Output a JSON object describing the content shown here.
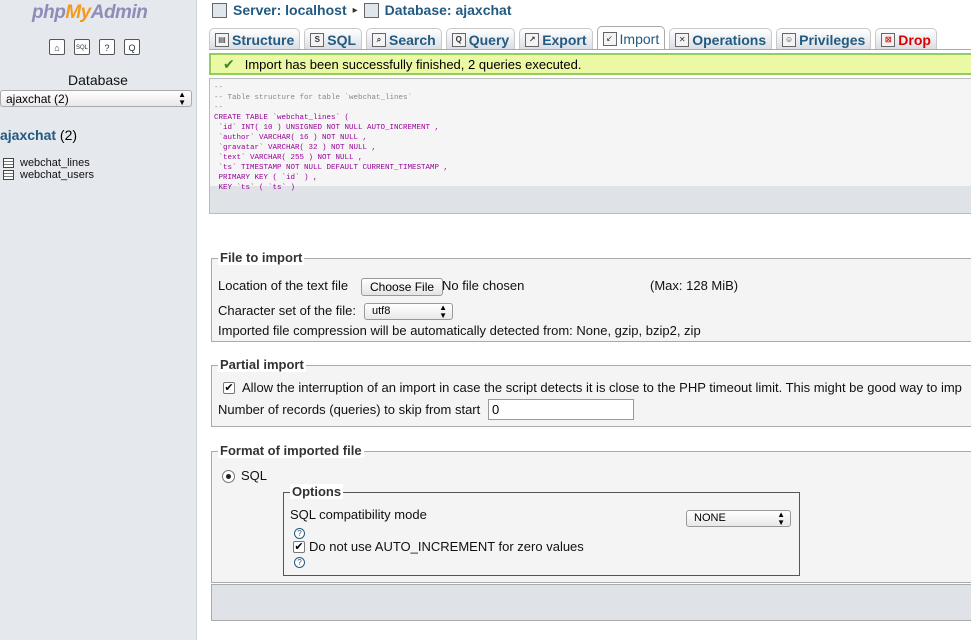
{
  "sidebar": {
    "logo": {
      "php": "php",
      "my": "My",
      "admin": "Admin"
    },
    "nav_icons": [
      "home-icon",
      "sql-icon",
      "help-icon",
      "query-icon"
    ],
    "nav_glyphs": {
      "home": "⌂",
      "sql": "SQL",
      "help": "?",
      "query": "Q"
    },
    "database_label": "Database",
    "database_select": "ajaxchat (2)",
    "db_name": "ajaxchat",
    "db_count": " (2)",
    "tables": [
      "webchat_lines",
      "webchat_users"
    ]
  },
  "breadcrumb": {
    "server": "Server: localhost",
    "separator": "▸",
    "database": "Database: ajaxchat"
  },
  "tabs": [
    {
      "label": "Structure",
      "icon": "structure-icon"
    },
    {
      "label": "SQL",
      "icon": "sql-icon"
    },
    {
      "label": "Search",
      "icon": "search-icon"
    },
    {
      "label": "Query",
      "icon": "query-icon"
    },
    {
      "label": "Export",
      "icon": "export-icon"
    },
    {
      "label": "Import",
      "icon": "import-icon",
      "active": true
    },
    {
      "label": "Operations",
      "icon": "operations-icon"
    },
    {
      "label": "Privileges",
      "icon": "privileges-icon"
    },
    {
      "label": "Drop",
      "icon": "drop-icon"
    }
  ],
  "message": {
    "check": "✔",
    "text": "Import has been successfully finished, 2 queries executed."
  },
  "sql_lines": [
    "--",
    "-- Table structure for table `webchat_lines`",
    "--",
    "CREATE TABLE `webchat_lines` (",
    " `id` INT( 10 ) UNSIGNED NOT NULL AUTO_INCREMENT ,",
    " `author` VARCHAR( 16 ) NOT NULL ,",
    " `gravatar` VARCHAR( 32 ) NOT NULL ,",
    " `text` VARCHAR( 255 ) NOT NULL ,",
    " `ts` TIMESTAMP NOT NULL DEFAULT CURRENT_TIMESTAMP ,",
    " PRIMARY KEY ( `id` ) ,",
    " KEY `ts` ( `ts` )"
  ],
  "file_import": {
    "legend": "File to import",
    "location_label": "Location of the text file",
    "choose_button": "Choose File",
    "no_file": "No file chosen",
    "max": "(Max: 128 MiB)",
    "charset_label": "Character set of the file:",
    "charset_value": "utf8",
    "compression_note": "Imported file compression will be automatically detected from: None, gzip, bzip2, zip"
  },
  "partial_import": {
    "legend": "Partial import",
    "checkbox_mark": "✔",
    "allow_interrupt": "Allow the interruption of an import in case the script detects it is close to the PHP timeout limit. This might be good way to imp",
    "skip_label": "Number of records (queries) to skip from start",
    "skip_value": "0"
  },
  "format": {
    "legend": "Format of imported file",
    "format_option": "SQL",
    "options_legend": "Options",
    "compat_label": "SQL compatibility mode",
    "compat_value": "NONE",
    "help_glyph": "?",
    "checkbox_mark": "✔",
    "no_auto_increment": "Do not use AUTO_INCREMENT for zero values"
  }
}
